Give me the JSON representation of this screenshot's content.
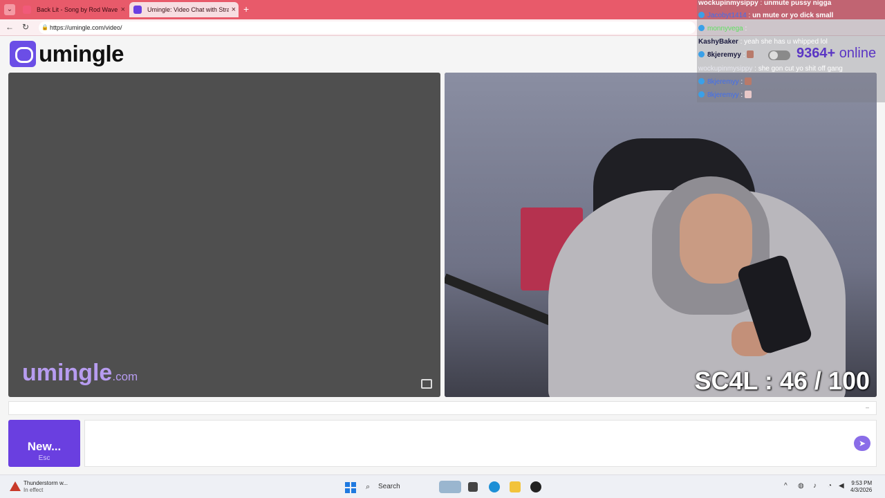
{
  "browser": {
    "tabs": [
      {
        "title": "Back Lit - Song by Rod Wave - Ap..."
      },
      {
        "title": "Umingle: Video Chat with Stra..."
      }
    ],
    "url": "https://umingle.com/video/"
  },
  "site": {
    "logo_text": "umingle",
    "watermark_main": "umingle",
    "watermark_domain": ".com"
  },
  "video": {
    "score": "SC4L : 46 / 100"
  },
  "controls": {
    "new_label": "New...",
    "new_sub": "Esc",
    "divider_dash": "–"
  },
  "overlay_chat": {
    "online_count": "9364+",
    "online_word": "online",
    "lines": [
      {
        "user": "wockupinmysippy",
        "sep": " : ",
        "msg": "unmute pussy nigga"
      },
      {
        "user": "Jacobyt1414",
        "sep": " : ",
        "msg": "un mute or yo dick small"
      },
      {
        "user": "monnyvega",
        "sep": " : ",
        "msg": ""
      },
      {
        "user": "KashyBaker",
        "sep": " : ",
        "msg": "yeah she has u whipped lol"
      },
      {
        "user": "8kjeremyy",
        "sep": " : ",
        "msg": ""
      },
      {
        "user": "wockupinmysippy",
        "sep": " : ",
        "msg": "she gon cut yo shit off gang"
      },
      {
        "user": "8kjeremyy",
        "sep": " : ",
        "msg": ""
      },
      {
        "user": "8kjeremyy",
        "sep": " : ",
        "msg": ""
      }
    ]
  },
  "taskbar": {
    "weather_title": "Thunderstorm w...",
    "weather_sub": "In effect",
    "search_label": "Search",
    "time": "9:53 PM",
    "date": "4/3/2026"
  }
}
